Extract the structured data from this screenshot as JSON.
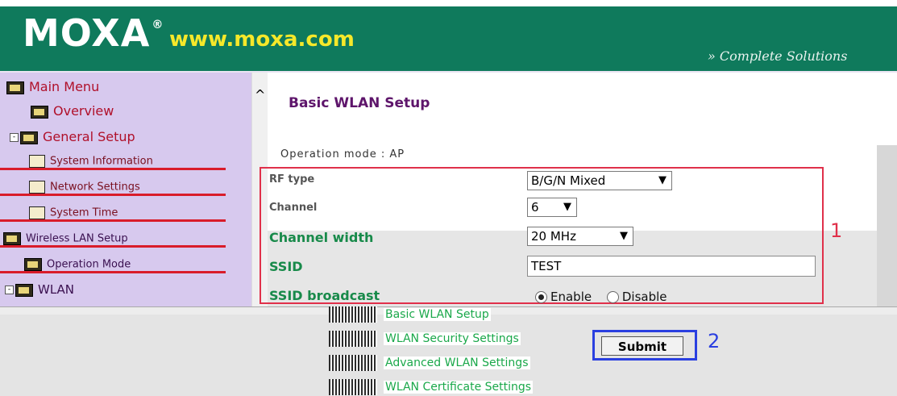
{
  "header": {
    "logo_text": "MOXA",
    "logo_mark": "®",
    "url": "www.moxa.com",
    "tagline": "» Complete Solutions"
  },
  "sidebar": {
    "items": [
      {
        "label": "Main Menu",
        "icon": "folder-open-icon"
      },
      {
        "label": "Overview",
        "icon": "folder-icon"
      },
      {
        "label": "General Setup",
        "icon": "folder-open-icon"
      },
      {
        "label": "System Information",
        "icon": "document-icon"
      },
      {
        "label": "Network Settings",
        "icon": "document-icon"
      },
      {
        "label": "System Time",
        "icon": "document-icon"
      },
      {
        "label": "Wireless LAN Setup",
        "icon": "folder-open-icon"
      },
      {
        "label": "Operation Mode",
        "icon": "document-icon"
      },
      {
        "label": "WLAN",
        "icon": "folder-open-icon"
      }
    ]
  },
  "main": {
    "title": "Basic WLAN Setup",
    "operation_mode": "Operation mode : AP",
    "fields": {
      "rf_type_label": "RF type",
      "rf_type_value": "B/G/N Mixed",
      "channel_label": "Channel",
      "channel_value": "6",
      "channel_width_label": "Channel width",
      "channel_width_value": "20 MHz",
      "ssid_label": "SSID",
      "ssid_value": "TEST",
      "ssid_broadcast_label": "SSID broadcast",
      "broadcast_enable": "Enable",
      "broadcast_disable": "Disable"
    },
    "annotation_1": "1"
  },
  "bottom": {
    "submenu": [
      "Basic WLAN Setup",
      "WLAN Security Settings",
      "Advanced WLAN Settings",
      "WLAN Certificate Settings"
    ],
    "submit_label": "Submit",
    "annotation_2": "2"
  },
  "colors": {
    "header_green": "#0f7a5c",
    "url_yellow": "#f6e82a",
    "sidebar_bg": "#d7c9ee",
    "label_green": "#188a4a",
    "title_purple": "#5e156b",
    "annotation_red": "#e0304a",
    "annotation_blue": "#2a3fe0"
  }
}
